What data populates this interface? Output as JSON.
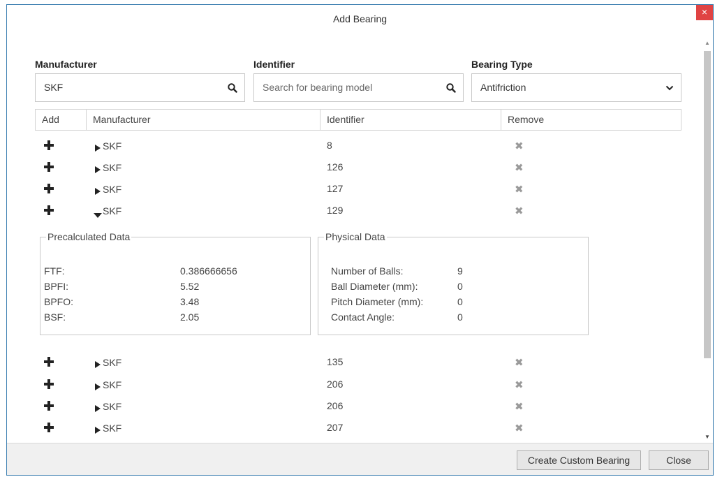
{
  "window": {
    "title": "Add Bearing",
    "close_glyph": "×"
  },
  "filters": {
    "manufacturer": {
      "label": "Manufacturer",
      "value": "SKF",
      "icon": "search-icon"
    },
    "identifier": {
      "label": "Identifier",
      "placeholder": "Search for bearing model",
      "icon": "search-icon"
    },
    "bearing_type": {
      "label": "Bearing Type",
      "value": "Antifriction",
      "icon": "chevron-down-icon"
    }
  },
  "table": {
    "columns": [
      "Add",
      "Manufacturer",
      "Identifier",
      "Remove"
    ],
    "rows_top": [
      {
        "manufacturer": "SKF",
        "identifier": "8",
        "expanded": false
      },
      {
        "manufacturer": "SKF",
        "identifier": "126",
        "expanded": false
      },
      {
        "manufacturer": "SKF",
        "identifier": "127",
        "expanded": false
      },
      {
        "manufacturer": "SKF",
        "identifier": "129",
        "expanded": true
      }
    ],
    "rows_bottom": [
      {
        "manufacturer": "SKF",
        "identifier": "135",
        "expanded": false
      },
      {
        "manufacturer": "SKF",
        "identifier": "206",
        "expanded": false
      },
      {
        "manufacturer": "SKF",
        "identifier": "206",
        "expanded": false
      },
      {
        "manufacturer": "SKF",
        "identifier": "207",
        "expanded": false
      }
    ]
  },
  "details": {
    "precalculated": {
      "title": "Precalculated Data",
      "items": [
        {
          "label": "FTF:",
          "value": "0.386666656"
        },
        {
          "label": "BPFI:",
          "value": "5.52"
        },
        {
          "label": "BPFO:",
          "value": "3.48"
        },
        {
          "label": "BSF:",
          "value": "2.05"
        }
      ]
    },
    "physical": {
      "title": "Physical Data",
      "items": [
        {
          "label": "Number of Balls:",
          "value": "9"
        },
        {
          "label": "Ball Diameter (mm):",
          "value": "0"
        },
        {
          "label": "Pitch Diameter (mm):",
          "value": "0"
        },
        {
          "label": "Contact Angle:",
          "value": "0"
        }
      ]
    }
  },
  "footer": {
    "create_label": "Create Custom Bearing",
    "close_label": "Close"
  },
  "colors": {
    "close_bg": "#e04343",
    "window_border": "#3c7fb1",
    "footer_bg": "#f0f0f0"
  }
}
